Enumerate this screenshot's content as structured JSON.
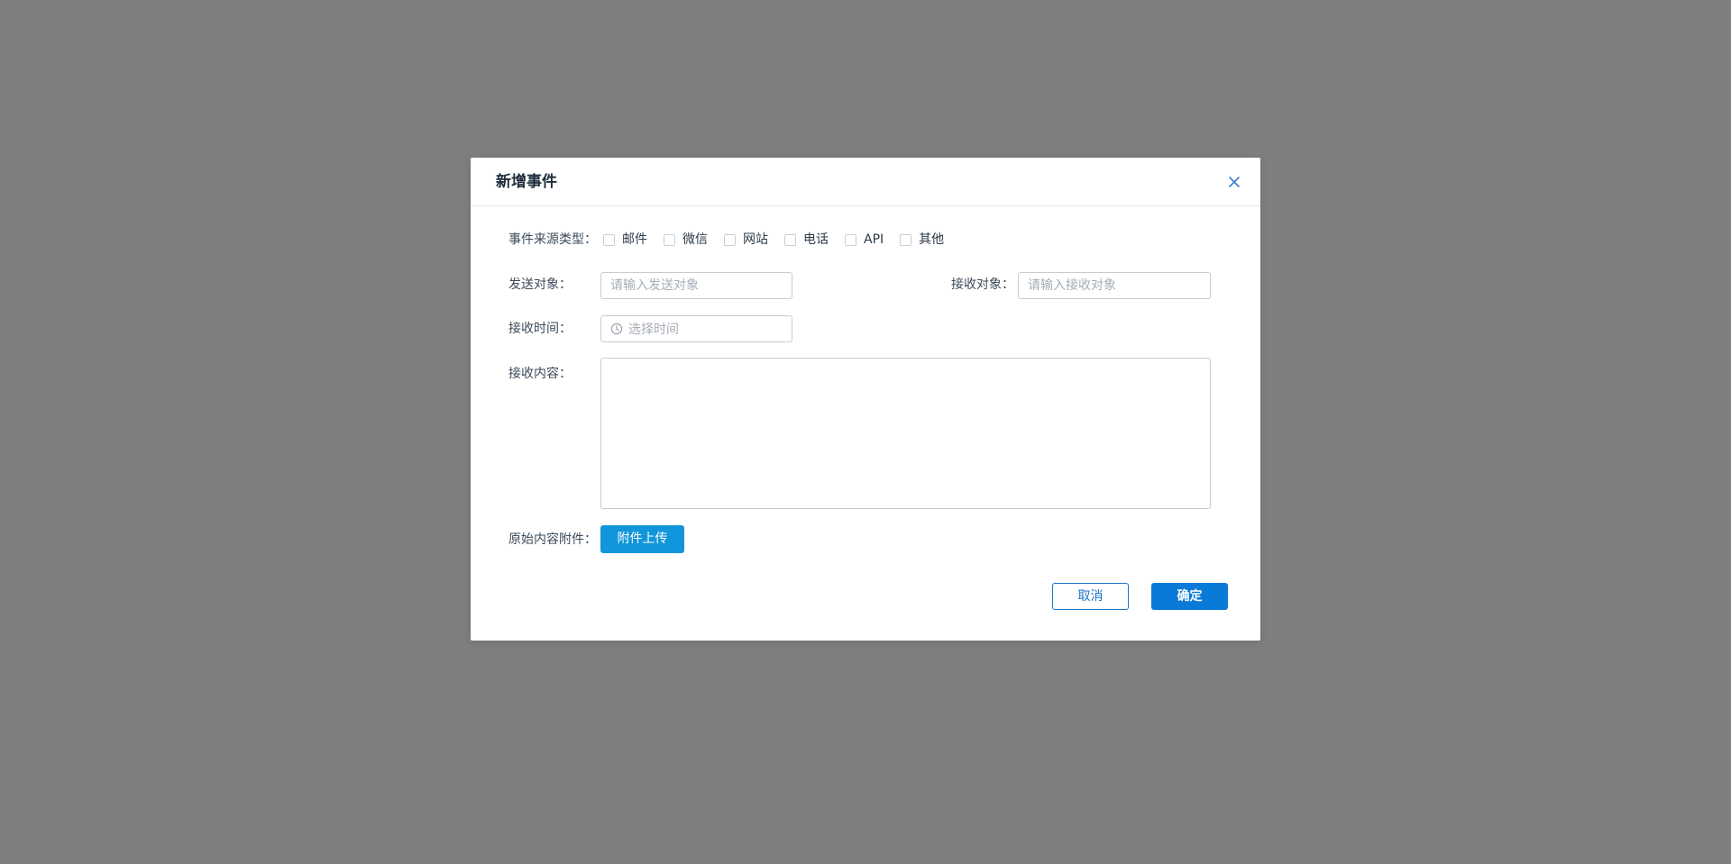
{
  "dialog": {
    "title": "新增事件",
    "close_icon": "close-icon"
  },
  "colors": {
    "overlay": "#7f7f7f",
    "primary": "#0a7ad8",
    "upload": "#1296db"
  },
  "form": {
    "source_type": {
      "label": "事件来源类型：",
      "options": [
        {
          "label": "邮件",
          "checked": false
        },
        {
          "label": "微信",
          "checked": false
        },
        {
          "label": "网站",
          "checked": false
        },
        {
          "label": "电话",
          "checked": false
        },
        {
          "label": "API",
          "checked": false
        },
        {
          "label": "其他",
          "checked": false
        }
      ]
    },
    "sender": {
      "label": "发送对象：",
      "placeholder": "请输入发送对象",
      "value": ""
    },
    "receiver": {
      "label": "接收对象：",
      "placeholder": "请输入接收对象",
      "value": ""
    },
    "receive_time": {
      "label": "接收时间：",
      "placeholder": "选择时间",
      "icon": "clock-icon"
    },
    "content": {
      "label": "接收内容：",
      "value": ""
    },
    "attachment": {
      "label": "原始内容附件：",
      "button_label": "附件上传"
    }
  },
  "footer": {
    "cancel_label": "取消",
    "ok_label": "确定"
  }
}
